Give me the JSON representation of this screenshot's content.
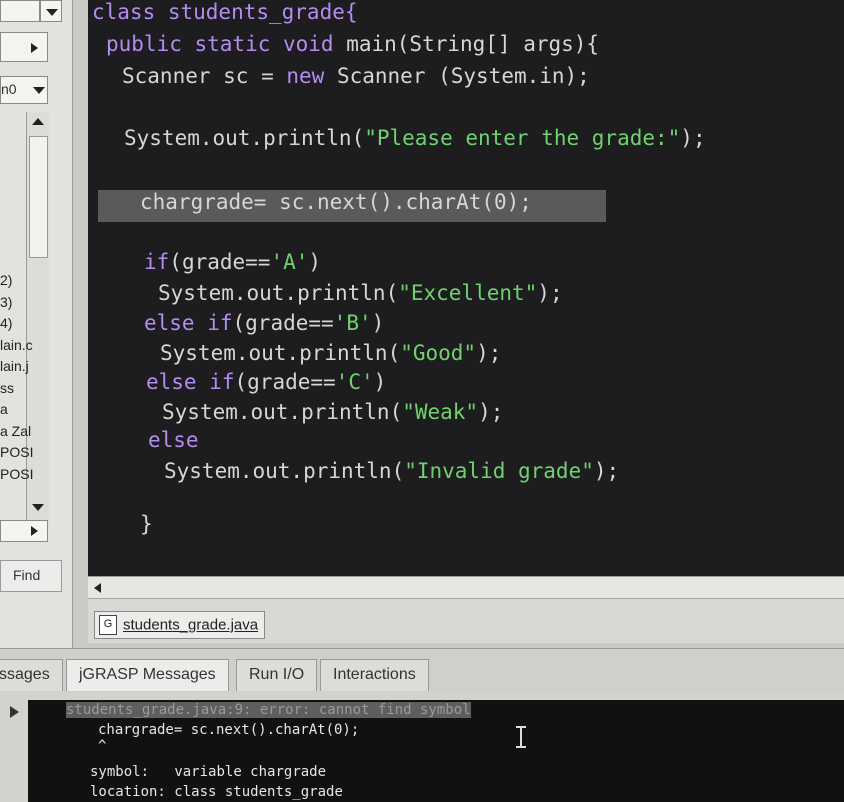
{
  "left_panel": {
    "dropdown_text": "n0",
    "files": [
      "2)",
      "3)",
      "4)",
      "lain.c",
      "lain.j",
      "ss",
      "a",
      "a Zal",
      "POSI",
      "POSI"
    ],
    "find_label": "Find"
  },
  "editor": {
    "lines": [
      {
        "parts": [
          {
            "t": "class students_grade{",
            "c": "kw"
          }
        ]
      },
      {
        "parts": [
          {
            "t": "public static void ",
            "c": "kw"
          },
          {
            "t": "main(String[] args){",
            "c": ""
          }
        ]
      },
      {
        "parts": [
          {
            "t": "Scanner sc = ",
            "c": ""
          },
          {
            "t": "new",
            "c": "kw"
          },
          {
            "t": " Scanner (System.in);",
            "c": ""
          }
        ]
      },
      {
        "parts": [
          {
            "t": "System.out.println(",
            "c": ""
          },
          {
            "t": "\"Please enter the grade:\"",
            "c": "str"
          },
          {
            "t": ");",
            "c": ""
          }
        ]
      },
      {
        "parts": [
          {
            "t": "chargrade= sc.next().charAt(0);",
            "c": ""
          }
        ]
      },
      {
        "parts": [
          {
            "t": "if",
            "c": "kw"
          },
          {
            "t": "(grade==",
            "c": ""
          },
          {
            "t": "'A'",
            "c": "chr"
          },
          {
            "t": ")",
            "c": ""
          }
        ]
      },
      {
        "parts": [
          {
            "t": "System.out.println(",
            "c": ""
          },
          {
            "t": "\"Excellent\"",
            "c": "str"
          },
          {
            "t": ");",
            "c": ""
          }
        ]
      },
      {
        "parts": [
          {
            "t": "else if",
            "c": "kw"
          },
          {
            "t": "(grade==",
            "c": ""
          },
          {
            "t": "'B'",
            "c": "chr"
          },
          {
            "t": ")",
            "c": ""
          }
        ]
      },
      {
        "parts": [
          {
            "t": "System.out.println(",
            "c": ""
          },
          {
            "t": "\"Good\"",
            "c": "str"
          },
          {
            "t": ");",
            "c": ""
          }
        ]
      },
      {
        "parts": [
          {
            "t": "else if",
            "c": "kw"
          },
          {
            "t": "(grade==",
            "c": ""
          },
          {
            "t": "'C'",
            "c": "chr"
          },
          {
            "t": ")",
            "c": ""
          }
        ]
      },
      {
        "parts": [
          {
            "t": "System.out.println(",
            "c": ""
          },
          {
            "t": "\"Weak\"",
            "c": "str"
          },
          {
            "t": ");",
            "c": ""
          }
        ]
      },
      {
        "parts": [
          {
            "t": "else",
            "c": "kw"
          }
        ]
      },
      {
        "parts": [
          {
            "t": "System.out.println(",
            "c": ""
          },
          {
            "t": "\"Invalid grade\"",
            "c": "str"
          },
          {
            "t": ");",
            "c": ""
          }
        ]
      },
      {
        "parts": [
          {
            "t": "}",
            "c": ""
          }
        ]
      }
    ]
  },
  "file_tab": {
    "icon_letter": "G",
    "label": "students_grade.java"
  },
  "message_tabs": [
    "ssages",
    "jGRASP Messages",
    "Run I/O",
    "Interactions"
  ],
  "console": {
    "error_line": "students_grade.java:9: error: cannot find symbol",
    "code_line": "chargrade= sc.next().charAt(0);",
    "caret_line": "^",
    "symbol_label": "symbol:",
    "symbol_value": "variable chargrade",
    "location_label": "location:",
    "location_value": "class students_grade"
  },
  "colors": {
    "keyword": "#b48cf0",
    "string": "#6fd26f",
    "editor_bg": "#1d1d1f"
  }
}
